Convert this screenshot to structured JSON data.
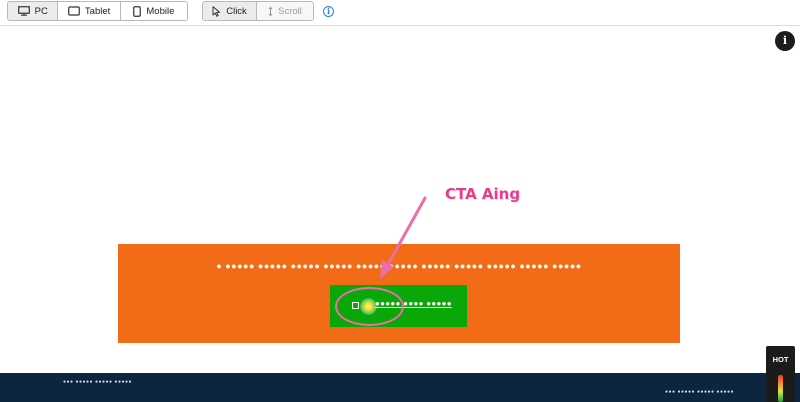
{
  "toolbar": {
    "device_tabs": [
      {
        "label": "PC",
        "icon": "desktop-icon",
        "active": true
      },
      {
        "label": "Tablet",
        "icon": "tablet-icon",
        "active": false
      },
      {
        "label": "Mobile",
        "icon": "mobile-icon",
        "active": false
      }
    ],
    "mode_tabs": [
      {
        "label": "Click",
        "icon": "cursor-icon",
        "active": true
      },
      {
        "label": "Scroll",
        "icon": "scroll-icon",
        "active": false
      }
    ],
    "info_icon": "info-icon"
  },
  "canvas": {
    "info_badge": "i",
    "banner": {
      "text": "● ●●●●● ●●●●● ●●●●● ●●●●● ●●●●● ●●●●● ●●●●● ●●●●● ●●●●● ●●●●● ●●●●●",
      "background": "#f26b16",
      "cta_text": "●●●●● ●●●● ●●●●●",
      "cta_background": "#0aa708"
    },
    "annotation": {
      "label": "CTA Aing",
      "color": "#ec3a8a"
    }
  },
  "footer": {
    "left_text": "●●● ●●●●● ●●●●● ●●●●●",
    "right_text": "●●● ●●●●● ●●●●● ●●●●●",
    "background": "#0c2540"
  },
  "heat_legend": {
    "label": "HOT"
  }
}
